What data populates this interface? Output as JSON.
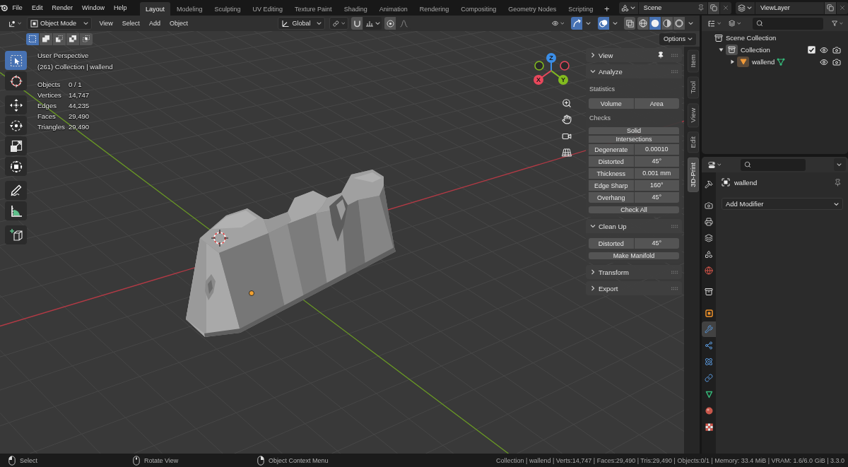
{
  "top_bar": {
    "menus": [
      "File",
      "Edit",
      "Render",
      "Window",
      "Help"
    ],
    "workspaces": [
      {
        "label": "Layout",
        "selected": true
      },
      {
        "label": "Modeling",
        "selected": false
      },
      {
        "label": "Sculpting",
        "selected": false
      },
      {
        "label": "UV Editing",
        "selected": false
      },
      {
        "label": "Texture Paint",
        "selected": false
      },
      {
        "label": "Shading",
        "selected": false
      },
      {
        "label": "Animation",
        "selected": false
      },
      {
        "label": "Rendering",
        "selected": false
      },
      {
        "label": "Compositing",
        "selected": false
      },
      {
        "label": "Geometry Nodes",
        "selected": false
      },
      {
        "label": "Scripting",
        "selected": false
      }
    ],
    "add_workspace": "+",
    "scene": "Scene",
    "view_layer": "ViewLayer"
  },
  "viewport": {
    "header": {
      "mode": "Object Mode",
      "menus": [
        "View",
        "Select",
        "Add",
        "Object"
      ],
      "orientation": "Global",
      "snap_on": false,
      "proportional_on": false,
      "gizmos_on": true,
      "overlays_on": true,
      "xray_on": false,
      "shading": [
        {
          "kind": "wireframe",
          "selected": false
        },
        {
          "kind": "solid",
          "selected": true
        },
        {
          "kind": "material",
          "selected": false
        },
        {
          "kind": "rendered",
          "selected": false
        }
      ]
    },
    "select_modes": [
      {
        "kind": "set",
        "selected": true
      },
      {
        "kind": "extend",
        "selected": false
      },
      {
        "kind": "subtract",
        "selected": false
      },
      {
        "kind": "difference",
        "selected": false
      },
      {
        "kind": "intersect",
        "selected": false
      }
    ],
    "options": "Options",
    "tool_groups": [
      [
        {
          "kind": "select_box",
          "selected": true
        },
        {
          "kind": "cursor",
          "selected": false
        }
      ],
      [
        {
          "kind": "move",
          "selected": false
        },
        {
          "kind": "rotate",
          "selected": false
        },
        {
          "kind": "scale",
          "selected": false
        },
        {
          "kind": "transform",
          "selected": false
        }
      ],
      [
        {
          "kind": "annotate",
          "selected": false
        },
        {
          "kind": "measure",
          "selected": false
        }
      ],
      [
        {
          "kind": "add_cube",
          "selected": false
        }
      ]
    ],
    "info": {
      "view": "User Perspective",
      "context": "(261) Collection | wallend",
      "stats": [
        {
          "label": "Objects",
          "value": "0 / 1"
        },
        {
          "label": "Vertices",
          "value": "14,747"
        },
        {
          "label": "Edges",
          "value": "44,235"
        },
        {
          "label": "Faces",
          "value": "29,490"
        },
        {
          "label": "Triangles",
          "value": "29,490"
        }
      ]
    },
    "gizmo": {
      "axes": [
        {
          "label": "Z",
          "color": "#3b8ee8",
          "negative_visible": false
        },
        {
          "label": "X",
          "color": "#e8475b",
          "negative_visible": true
        },
        {
          "label": "Y",
          "color": "#82bb1f",
          "negative_visible": true
        }
      ]
    },
    "sidebar": {
      "panels": [
        {
          "title": "View",
          "expanded": false,
          "pinned": true
        },
        {
          "title": "Analyze",
          "expanded": true,
          "pinned": false,
          "items": [
            {
              "kind": "heading",
              "text": "Statistics"
            },
            {
              "kind": "row",
              "buttons": [
                "Volume",
                "Area"
              ]
            },
            {
              "kind": "heading",
              "text": "Checks"
            },
            {
              "kind": "stack",
              "rows": [
                {
                  "label": "Solid"
                },
                {
                  "label": "Intersections"
                },
                {
                  "label": "Degenerate",
                  "value": "0.00010"
                },
                {
                  "label": "Distorted",
                  "value": "45°"
                },
                {
                  "label": "Thickness",
                  "value": "0.001 mm"
                },
                {
                  "label": "Edge Sharp",
                  "value": "160°"
                },
                {
                  "label": "Overhang",
                  "value": "45°"
                }
              ]
            },
            {
              "kind": "stack",
              "rows": [
                {
                  "label": "Check All"
                }
              ]
            }
          ]
        },
        {
          "title": "Clean Up",
          "expanded": true,
          "pinned": false,
          "items": [
            {
              "kind": "stack",
              "rows": [
                {
                  "label": "Distorted",
                  "value": "45°"
                }
              ]
            },
            {
              "kind": "stack",
              "rows": [
                {
                  "label": "Make Manifold"
                }
              ]
            }
          ]
        },
        {
          "title": "Transform",
          "expanded": false,
          "pinned": false
        },
        {
          "title": "Export",
          "expanded": false,
          "pinned": false
        }
      ],
      "tabs": [
        {
          "label": "Item",
          "selected": false
        },
        {
          "label": "Tool",
          "selected": false
        },
        {
          "label": "View",
          "selected": false
        },
        {
          "label": "Edit",
          "selected": false
        },
        {
          "label": "3D-Print",
          "selected": true
        }
      ]
    }
  },
  "outliner": {
    "tree": [
      {
        "label": "Scene Collection",
        "kind": "scene",
        "children": [
          {
            "label": "Collection",
            "kind": "collection",
            "expanded": true,
            "checked": true,
            "children": [
              {
                "label": "wallend",
                "kind": "mesh",
                "expanded": false
              }
            ]
          }
        ]
      }
    ]
  },
  "properties": {
    "tab_groups": [
      [
        {
          "kind": "tool",
          "selected": false
        }
      ],
      [
        {
          "kind": "render",
          "selected": false
        },
        {
          "kind": "output",
          "selected": false
        },
        {
          "kind": "view_layer",
          "selected": false
        },
        {
          "kind": "scene",
          "selected": false
        },
        {
          "kind": "world",
          "selected": false
        }
      ],
      [
        {
          "kind": "collection",
          "selected": false
        }
      ],
      [
        {
          "kind": "object",
          "selected": false
        },
        {
          "kind": "modifiers",
          "selected": true
        },
        {
          "kind": "particles",
          "selected": false
        },
        {
          "kind": "physics",
          "selected": false
        },
        {
          "kind": "constraints",
          "selected": false
        },
        {
          "kind": "data",
          "selected": false
        },
        {
          "kind": "material",
          "selected": false
        },
        {
          "kind": "texture",
          "selected": false
        }
      ]
    ],
    "object": "wallend",
    "add_modifier": "Add Modifier"
  },
  "status_bar": {
    "hints": [
      {
        "kind": "left",
        "label": "Select"
      },
      {
        "kind": "middle",
        "label": "Rotate View"
      },
      {
        "kind": "right",
        "label": "Object Context Menu"
      }
    ],
    "info": "Collection | wallend | Verts:14,747 | Faces:29,490 | Tris:29,490 | Objects:0/1 | Memory: 33.4 MiB | VRAM: 1.6/6.0 GiB | 3.3.0"
  }
}
